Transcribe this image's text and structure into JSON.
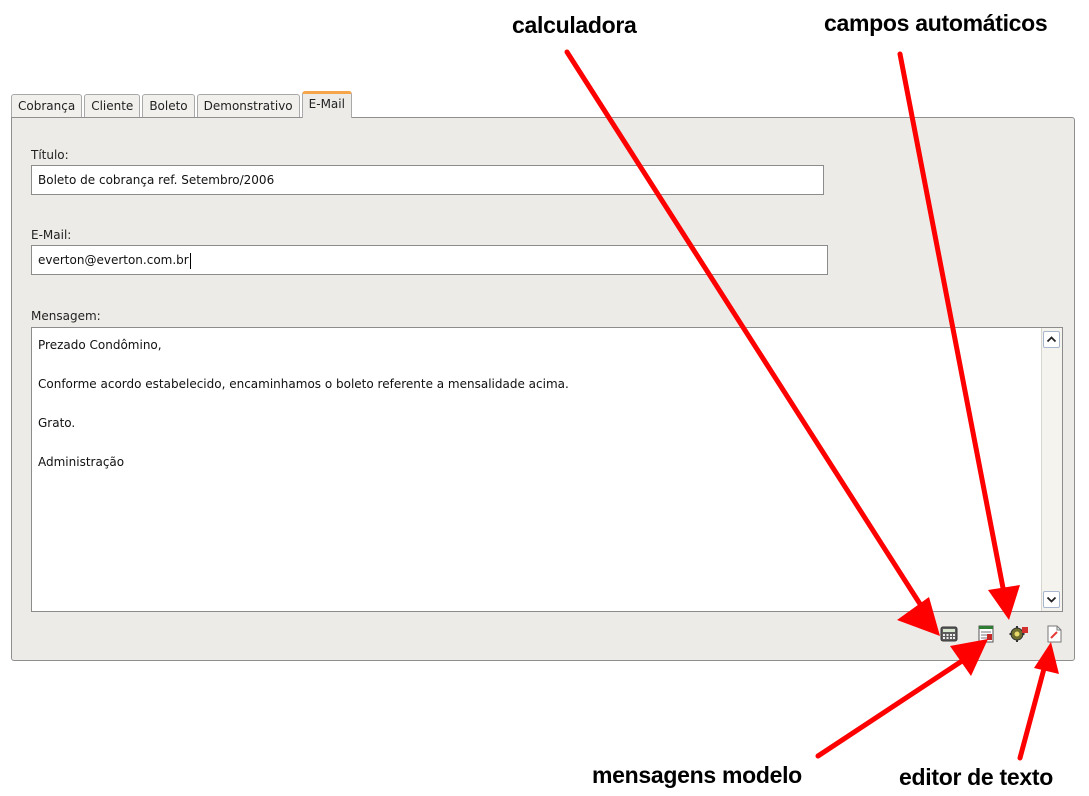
{
  "annotations": {
    "calculator": "calculadora",
    "auto_fields": "campos automáticos",
    "template_messages": "mensagens modelo",
    "text_editor": "editor de texto"
  },
  "tabs": [
    {
      "label": "Cobrança"
    },
    {
      "label": "Cliente"
    },
    {
      "label": "Boleto"
    },
    {
      "label": "Demonstrativo"
    },
    {
      "label": "E-Mail",
      "active": true
    }
  ],
  "form": {
    "title_label": "Título:",
    "title_value": "Boleto de cobrança ref. Setembro/2006",
    "email_label": "E-Mail:",
    "email_value": "everton@everton.com.br",
    "message_label": "Mensagem:",
    "message_lines": [
      "Prezado Condômino,",
      "Conforme acordo estabelecido, encaminhamos o boleto referente a mensalidade acima.",
      "Grato.",
      "Administração"
    ]
  },
  "toolbar_icons": [
    "calculator-icon",
    "template-messages-icon",
    "auto-fields-icon",
    "text-editor-icon"
  ],
  "colors": {
    "active_tab_accent": "#f5a64a",
    "arrow": "#ff0000",
    "panel_bg": "#ecebe7"
  }
}
